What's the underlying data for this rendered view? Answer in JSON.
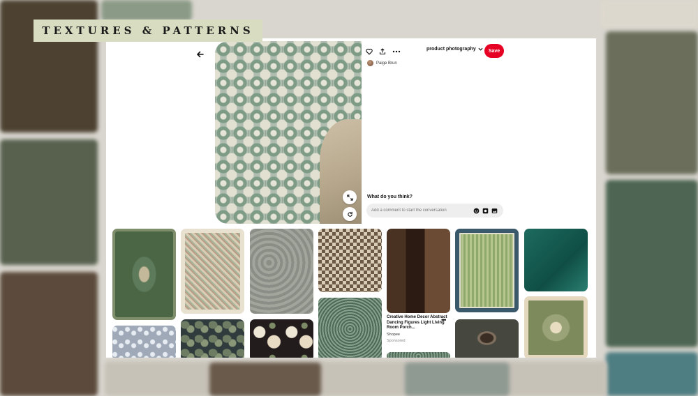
{
  "banner": {
    "title": "TEXTURES & PATTERNS"
  },
  "pin": {
    "board": "product photography",
    "save_label": "Save",
    "author": "Paige Brun",
    "comment_prompt": "What do you think?",
    "comment_placeholder": "Add a comment to start the conversation"
  },
  "feed": {
    "sponsored_pin": {
      "title": "Creative Home Decor Abstract Dancing Figures Light Living Room Porch...",
      "source": "Shopee",
      "label": "Sponsored"
    }
  },
  "icons": {
    "back": "arrow-left-icon",
    "like": "heart-icon",
    "share": "share-icon",
    "more": "more-dots-icon",
    "board_dropdown": "chevron-down-icon",
    "expand": "expand-icon",
    "visual_search": "visual-search-icon",
    "emoji": "emoji-icon",
    "sticker": "sticker-icon",
    "image": "image-icon"
  },
  "colors": {
    "save": "#e60023",
    "banner": "#d8dcc0"
  }
}
